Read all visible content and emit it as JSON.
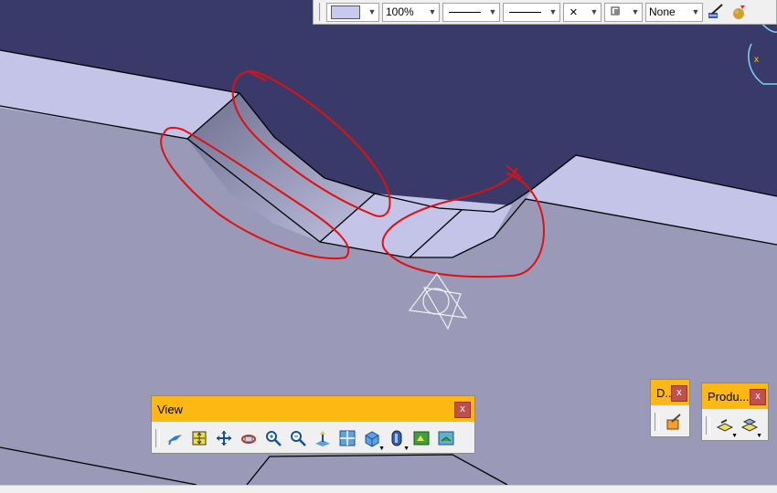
{
  "toolbar": {
    "zoom_value": "100%",
    "layer_value": "None",
    "x_symbol": "×",
    "fill_color": "#c8c8f0"
  },
  "view_panel": {
    "title": "View",
    "close_label": "x",
    "buttons": [
      {
        "name": "fly-mode-icon"
      },
      {
        "name": "fit-all-in-icon"
      },
      {
        "name": "pan-icon"
      },
      {
        "name": "rotate-icon"
      },
      {
        "name": "zoom-in-icon"
      },
      {
        "name": "zoom-out-icon"
      },
      {
        "name": "normal-view-icon"
      },
      {
        "name": "multi-view-icon"
      },
      {
        "name": "isometric-view-icon"
      },
      {
        "name": "shading-icon"
      },
      {
        "name": "hide-show-icon"
      },
      {
        "name": "swap-visible-space-icon"
      }
    ]
  },
  "d_panel": {
    "title": "D..",
    "close_label": "x"
  },
  "product_panel": {
    "title": "Produ...",
    "close_label": "x"
  },
  "compass_label": "x",
  "colors": {
    "background_top": "#3a3a6a",
    "face_light": "#c4c4e8",
    "face_mid": "#9a9ab8",
    "annotation": "#e01010",
    "title_bar": "#fdb813"
  }
}
